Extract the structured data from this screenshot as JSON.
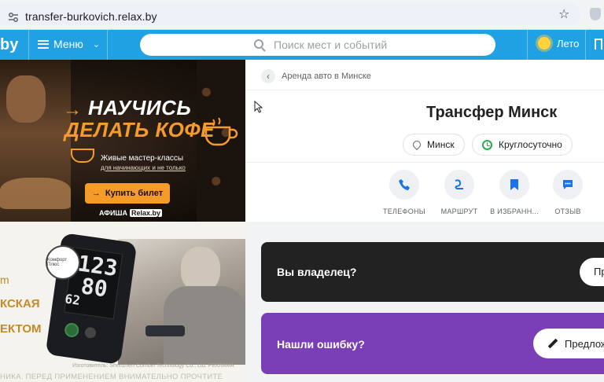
{
  "browser": {
    "url": "transfer-burkovich.relax.by"
  },
  "header": {
    "logo_fragment": "by",
    "menu_label": "Меню",
    "search_placeholder": "Поиск мест и событий",
    "season_label": "Лето"
  },
  "ads": {
    "coffee": {
      "line1": "НАУЧИСЬ",
      "line2": "ДЕЛАТЬ КОФЕ",
      "sub1": "Живые мастер-классы",
      "sub2": "для начинающих и не только",
      "button": "Купить билет",
      "brand_main": "АФИША",
      "brand_box": "Relax.by"
    },
    "monitor": {
      "word_fragment": "m",
      "line1": "КСКАЯ",
      "line2": "ЕКТОМ",
      "digits_top": "123",
      "digits_mid": "80",
      "digits_low": "62",
      "comfort_badge": "Комфорт Плюс",
      "maker_note": "Изготовитель: Shenzhen Combei Technology Co., Ltd. РЕКЛАМА",
      "warning": "НИКА. ПЕРЕД ПРИМЕНЕНИЕМ ВНИМАТЕЛЬНО ПРОЧТИТЕ ИНСТРУКЦИЮ"
    }
  },
  "place": {
    "breadcrumb": "Аренда авто в Минске",
    "title": "Трансфер Минск",
    "city": "Минск",
    "hours": "Круглосуточно",
    "actions": [
      {
        "label": "Телефоны",
        "icon": "phone-icon"
      },
      {
        "label": "Маршрут",
        "icon": "route-icon"
      },
      {
        "label": "В избранн...",
        "icon": "bookmark-icon"
      },
      {
        "label": "Отзыв",
        "icon": "comment-icon"
      }
    ]
  },
  "owner_block": {
    "text": "Вы владелец?",
    "button": "Пр"
  },
  "error_block": {
    "text": "Нашли ошибку?",
    "button": "Предлож"
  },
  "colors": {
    "header_blue": "#1fa1e4",
    "accent_orange": "#f59b2a",
    "owner_dark": "#222222",
    "error_purple": "#7a3fb7",
    "action_blue": "#1a73e8",
    "clock_green": "#2fa84f"
  }
}
